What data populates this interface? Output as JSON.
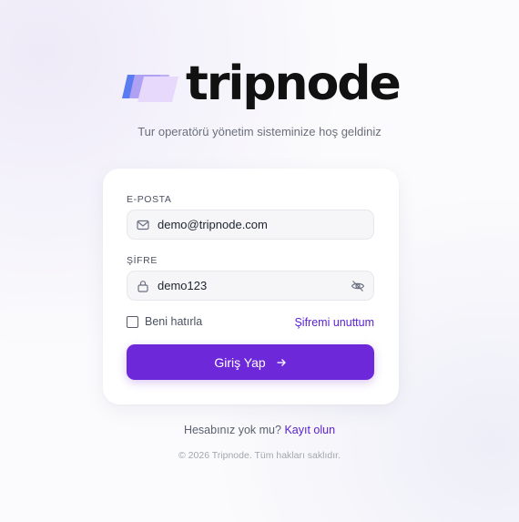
{
  "brand": {
    "name": "tripnode",
    "tagline": "Tur operatörü yönetim sisteminize hoş geldiniz",
    "logo_colors": [
      "#5b7cf0",
      "#b8a6f4",
      "#e6d9fb"
    ]
  },
  "login_form": {
    "email_label": "E-POSTA",
    "email_value": "demo@tripnode.com",
    "email_icon": "mail-icon",
    "password_label": "ŞİFRE",
    "password_value": "demo123",
    "password_icon": "lock-icon",
    "toggle_icon": "eye-off-icon",
    "remember_label": "Beni hatırla",
    "remember_checked": false,
    "forgot_label": "Şifremi unuttum",
    "submit_label": "Giriş Yap",
    "submit_icon": "arrow-right-icon"
  },
  "signup": {
    "prompt": "Hesabınız yok mu?",
    "link_label": "Kayıt olun"
  },
  "footer": {
    "copyright": "© 2026 Tripnode. Tüm hakları saklıdır."
  },
  "colors": {
    "accent": "#6d28d9",
    "link": "#5b21d1",
    "background": "#fbfbfd"
  }
}
